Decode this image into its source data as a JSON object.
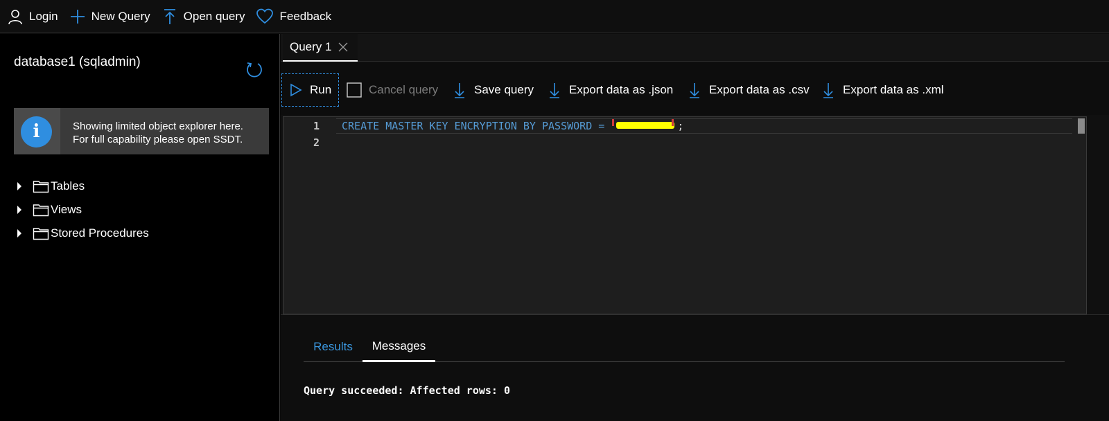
{
  "topbar": {
    "login": "Login",
    "new_query": "New Query",
    "open_query": "Open query",
    "feedback": "Feedback"
  },
  "sidebar": {
    "database_title": "database1 (sqladmin)",
    "info": {
      "line1": "Showing limited object explorer here.",
      "line2": "For full capability please open SSDT."
    },
    "tree": [
      {
        "label": "Tables",
        "icon": "folder-icon"
      },
      {
        "label": "Views",
        "icon": "folder-icon"
      },
      {
        "label": "Stored Procedures",
        "icon": "folder-icon"
      }
    ]
  },
  "tabs": [
    {
      "label": "Query 1"
    }
  ],
  "toolbar": {
    "run": "Run",
    "cancel": "Cancel query",
    "save": "Save query",
    "export_json": "Export data as .json",
    "export_csv": "Export data as .csv",
    "export_xml": "Export data as .xml"
  },
  "editor": {
    "lines": [
      {
        "number": "1",
        "keywords": "CREATE MASTER KEY ENCRYPTION BY PASSWORD = ",
        "terminator": ";"
      },
      {
        "number": "2",
        "keywords": "",
        "terminator": ""
      }
    ]
  },
  "results": {
    "tab_results": "Results",
    "tab_messages": "Messages",
    "message": "Query succeeded: Affected rows: 0"
  },
  "colors": {
    "accent": "#2f8ee0",
    "keyword": "#569cd6",
    "redaction": "#ffff00"
  }
}
